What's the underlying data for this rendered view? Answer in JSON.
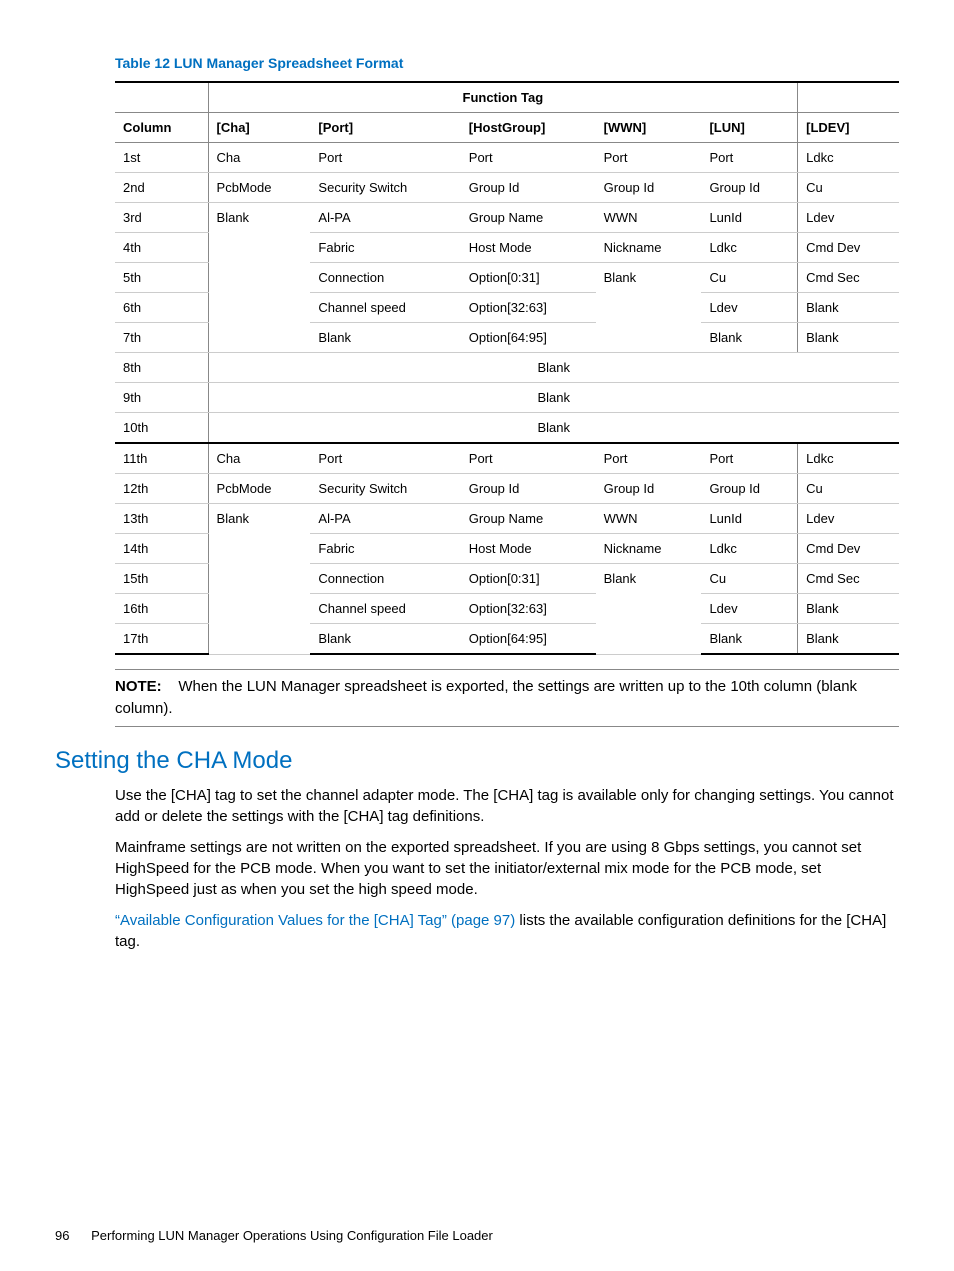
{
  "tableTitle": "Table 12 LUN Manager Spreadsheet Format",
  "header": {
    "functionTag": "Function Tag",
    "column": "Column",
    "cha": "[Cha]",
    "port": "[Port]",
    "hostGroup": "[HostGroup]",
    "wwn": "[WWN]",
    "lun": "[LUN]",
    "ldev": "[LDEV]"
  },
  "rows": [
    {
      "col": "1st",
      "cha": "Cha",
      "port": "Port",
      "hg": "Port",
      "wwn": "Port",
      "lun": "Port",
      "ldev": "Ldkc"
    },
    {
      "col": "2nd",
      "cha": "PcbMode",
      "port": "Security Switch",
      "hg": "Group Id",
      "wwn": "Group Id",
      "lun": "Group Id",
      "ldev": "Cu"
    },
    {
      "col": "3rd",
      "cha": "Blank",
      "port": "Al-PA",
      "hg": "Group Name",
      "wwn": "WWN",
      "lun": "LunId",
      "ldev": "Ldev"
    },
    {
      "col": "4th",
      "port": "Fabric",
      "hg": "Host Mode",
      "wwn": "Nickname",
      "lun": "Ldkc",
      "ldev": "Cmd Dev"
    },
    {
      "col": "5th",
      "port": "Connection",
      "hg": "Option[0:31]",
      "wwn": "Blank",
      "lun": "Cu",
      "ldev": "Cmd Sec"
    },
    {
      "col": "6th",
      "port": "Channel speed",
      "hg": "Option[32:63]",
      "lun": "Ldev",
      "ldev": "Blank"
    },
    {
      "col": "7th",
      "port": "Blank",
      "hg": "Option[64:95]",
      "lun": "Blank",
      "ldev": "Blank"
    },
    {
      "col": "8th",
      "span": "Blank"
    },
    {
      "col": "9th",
      "span": "Blank"
    },
    {
      "col": "10th",
      "span": "Blank"
    },
    {
      "col": "11th",
      "cha": "Cha",
      "port": "Port",
      "hg": "Port",
      "wwn": "Port",
      "lun": "Port",
      "ldev": "Ldkc"
    },
    {
      "col": "12th",
      "cha": "PcbMode",
      "port": "Security Switch",
      "hg": "Group Id",
      "wwn": "Group Id",
      "lun": "Group Id",
      "ldev": "Cu"
    },
    {
      "col": "13th",
      "cha": "Blank",
      "port": "Al-PA",
      "hg": "Group Name",
      "wwn": "WWN",
      "lun": "LunId",
      "ldev": "Ldev"
    },
    {
      "col": "14th",
      "port": "Fabric",
      "hg": "Host Mode",
      "wwn": "Nickname",
      "lun": "Ldkc",
      "ldev": "Cmd Dev"
    },
    {
      "col": "15th",
      "port": "Connection",
      "hg": "Option[0:31]",
      "wwn": "Blank",
      "lun": "Cu",
      "ldev": "Cmd Sec"
    },
    {
      "col": "16th",
      "port": "Channel speed",
      "hg": "Option[32:63]",
      "lun": "Ldev",
      "ldev": "Blank"
    },
    {
      "col": "17th",
      "port": "Blank",
      "hg": "Option[64:95]",
      "lun": "Blank",
      "ldev": "Blank"
    }
  ],
  "note": {
    "label": "NOTE:",
    "text": "When the LUN Manager spreadsheet is exported, the settings are written up to the 10th column (blank column)."
  },
  "sectionTitle": "Setting the CHA Mode",
  "para1": "Use the [CHA] tag to set the channel adapter mode. The [CHA] tag is available only for changing settings. You cannot add or delete the settings with the [CHA] tag definitions.",
  "para2": "Mainframe settings are not written on the exported spreadsheet. If you are using 8 Gbps settings, you cannot set HighSpeed for the PCB mode. When you want to set the initiator/external mix mode for the PCB mode, set HighSpeed just as when you set the high speed mode.",
  "para3link": "“Available Configuration Values for the [CHA] Tag” (page 97)",
  "para3rest": " lists the available configuration definitions for the [CHA] tag.",
  "footer": {
    "pageNum": "96",
    "text": "Performing LUN Manager Operations Using Configuration File Loader"
  }
}
